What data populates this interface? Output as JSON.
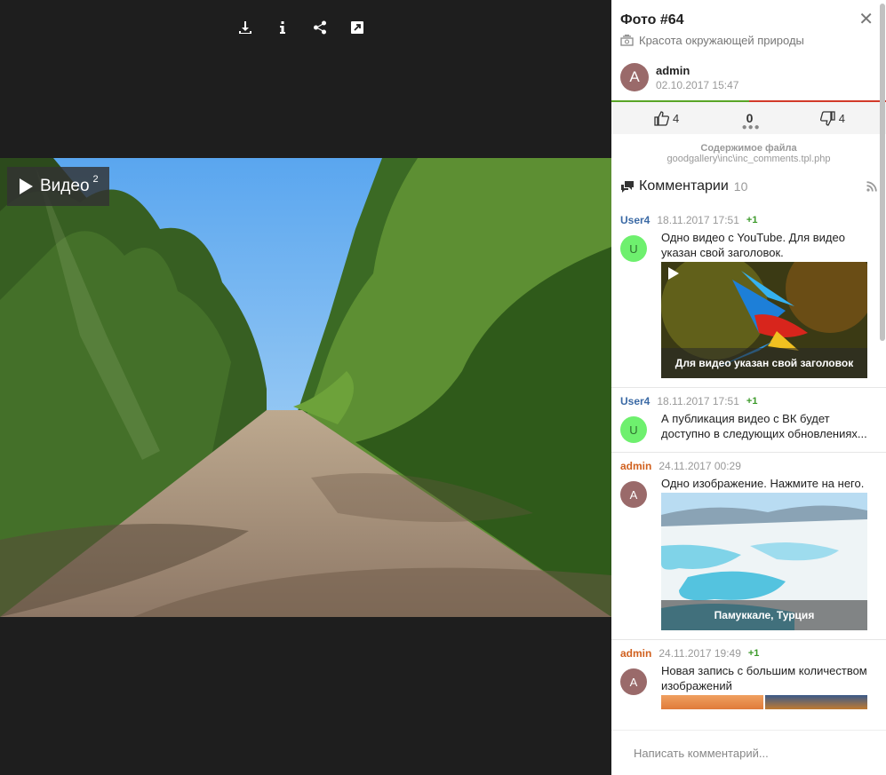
{
  "viewer": {
    "toolbar": [
      {
        "name": "download-icon"
      },
      {
        "name": "info-icon"
      },
      {
        "name": "share-icon"
      },
      {
        "name": "fullscreen-icon"
      }
    ],
    "video_badge": {
      "label": "Видео",
      "count": "2"
    }
  },
  "photo": {
    "title": "Фото #64",
    "album": "Красота окружающей природы",
    "author": {
      "initial": "A",
      "name": "admin",
      "date": "02.10.2017 15:47"
    },
    "votes": {
      "likes": "4",
      "score": "0",
      "dislikes": "4"
    },
    "file": {
      "label": "Содержимое файла",
      "path": "goodgallery\\inc\\inc_comments.tpl.php"
    }
  },
  "comments_header": {
    "title": "Комментарии",
    "count": "10"
  },
  "comments": [
    {
      "user": "User4",
      "date": "18.11.2017 17:51",
      "rating": "+1",
      "initial": "U",
      "text": "Одно видео с YouTube. Для видео указан свой заголовок.",
      "media_caption": "Для видео указан свой заголовок"
    },
    {
      "user": "User4",
      "date": "18.11.2017 17:51",
      "rating": "+1",
      "initial": "U",
      "text": "А публикация видео с ВК будет доступно в следующих обновлениях..."
    },
    {
      "user": "admin",
      "date": "24.11.2017 00:29",
      "initial": "A",
      "text": "Одно изображение. Нажмите на него.",
      "media_caption": "Памуккале, Турция"
    },
    {
      "user": "admin",
      "date": "24.11.2017 19:49",
      "rating": "+1",
      "initial": "A",
      "text": "Новая запись с большим количеством изображений"
    }
  ],
  "compose": {
    "placeholder": "Написать комментарий..."
  },
  "colors": {
    "like_bar": "#59a527",
    "dislike_bar": "#d23a2a",
    "user_link": "#3b6aa5",
    "admin_link": "#d0601e",
    "plus": "#3c9a2a"
  }
}
